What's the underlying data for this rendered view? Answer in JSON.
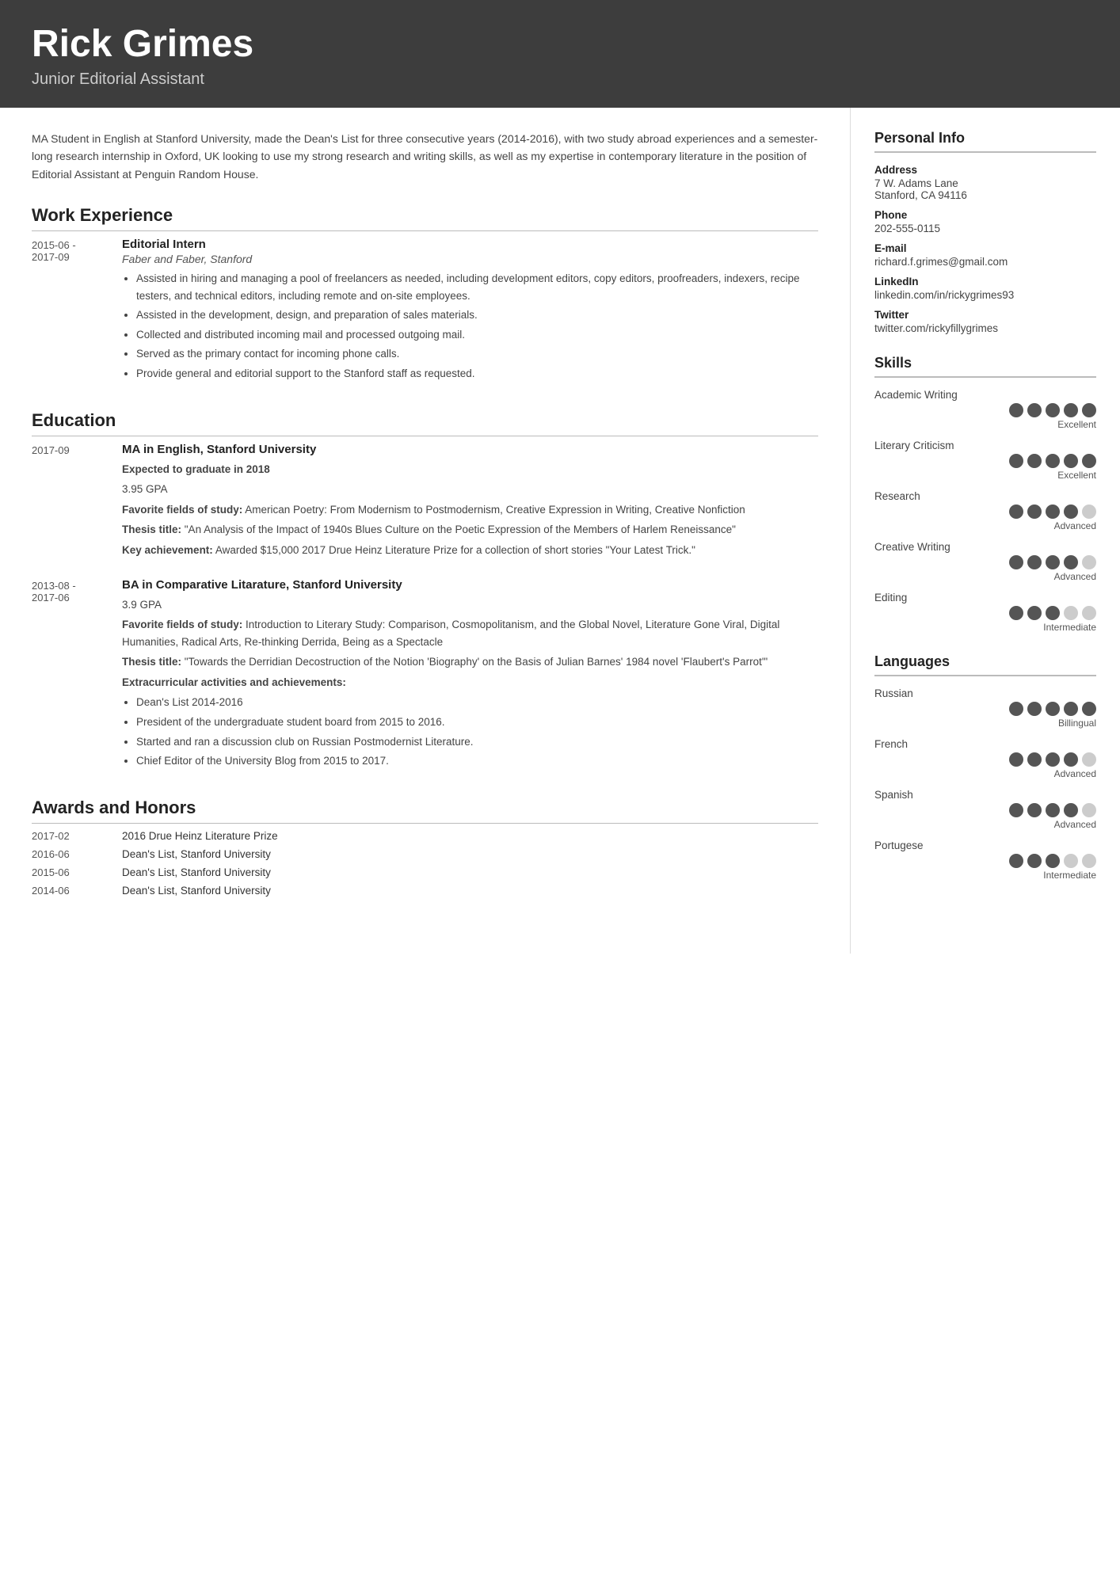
{
  "header": {
    "name": "Rick Grimes",
    "title": "Junior Editorial Assistant"
  },
  "summary": "MA Student in English at Stanford University, made the Dean's List for three consecutive years (2014-2016), with two study abroad experiences and a semester-long research internship in Oxford, UK looking to use my strong research and writing skills, as well as my expertise in contemporary literature in the position of Editorial Assistant at Penguin Random House.",
  "sections": {
    "work_experience": {
      "label": "Work Experience",
      "entries": [
        {
          "date": "2015-06 - 2017-09",
          "title": "Editorial Intern",
          "subtitle": "Faber and Faber, Stanford",
          "bullets": [
            "Assisted in hiring and managing a pool of freelancers as needed, including development editors, copy editors, proofreaders, indexers, recipe testers, and technical editors, including remote and on-site employees.",
            "Assisted in the development, design, and preparation of sales materials.",
            "Collected and distributed incoming mail and processed outgoing mail.",
            "Served as the primary contact for incoming phone calls.",
            "Provide general and editorial support to the Stanford staff as requested."
          ]
        }
      ]
    },
    "education": {
      "label": "Education",
      "entries": [
        {
          "date": "2017-09",
          "title": "MA in English, Stanford University",
          "subtitle": "",
          "details": [
            {
              "bold": true,
              "text": "Expected to graduate in 2018"
            },
            {
              "bold": false,
              "text": "3.95 GPA"
            },
            {
              "bold_prefix": "Favorite fields of study:",
              "text": " American Poetry: From Modernism to Postmodernism, Creative Expression in Writing, Creative Nonfiction"
            },
            {
              "bold_prefix": "Thesis title:",
              "text": " \"An Analysis of the Impact of 1940s Blues Culture on the Poetic Expression of the Members of Harlem Reneissance\""
            },
            {
              "bold_prefix": "Key achievement:",
              "text": " Awarded $15,000 2017 Drue Heinz Literature Prize for a collection of short stories \"Your Latest Trick.\""
            }
          ]
        },
        {
          "date": "2013-08 - 2017-06",
          "title": "BA in Comparative Litarature, Stanford University",
          "subtitle": "",
          "details": [
            {
              "bold": false,
              "text": "3.9 GPA"
            },
            {
              "bold_prefix": "Favorite fields of study:",
              "text": " Introduction to Literary Study: Comparison, Cosmopolitanism, and the Global Novel, Literature Gone Viral, Digital Humanities, Radical Arts, Re-thinking Derrida, Being as a Spectacle"
            },
            {
              "bold_prefix": "Thesis title:",
              "text": " \"Towards the Derridian Decostruction of the Notion 'Biography' on the Basis of Julian Barnes' 1984 novel 'Flaubert's Parrot'\""
            },
            {
              "bold_prefix": "Extracurricular activities and achievements:",
              "text": ""
            }
          ],
          "bullets": [
            "Dean's List 2014-2016",
            "President of the undergraduate student board from 2015 to 2016.",
            "Started and ran a discussion club on Russian Postmodernist Literature.",
            "Chief Editor of the University Blog from 2015 to 2017."
          ]
        }
      ]
    },
    "awards": {
      "label": "Awards and Honors",
      "entries": [
        {
          "date": "2017-02",
          "title": "2016 Drue Heinz Literature Prize"
        },
        {
          "date": "2016-06",
          "title": "Dean's List, Stanford University"
        },
        {
          "date": "2015-06",
          "title": "Dean's List, Stanford University"
        },
        {
          "date": "2014-06",
          "title": "Dean's List, Stanford University"
        }
      ]
    }
  },
  "sidebar": {
    "personal_info": {
      "label": "Personal Info",
      "fields": [
        {
          "label": "Address",
          "value": "7 W. Adams Lane\nStanford, CA 94116"
        },
        {
          "label": "Phone",
          "value": "202-555-0115"
        },
        {
          "label": "E-mail",
          "value": "richard.f.grimes@gmail.com"
        },
        {
          "label": "LinkedIn",
          "value": "linkedin.com/in/rickygrimes93"
        },
        {
          "label": "Twitter",
          "value": "twitter.com/rickyfillygrimes"
        }
      ]
    },
    "skills": {
      "label": "Skills",
      "items": [
        {
          "name": "Academic Writing",
          "filled": 5,
          "total": 5,
          "level": "Excellent"
        },
        {
          "name": "Literary Criticism",
          "filled": 5,
          "total": 5,
          "level": "Excellent"
        },
        {
          "name": "Research",
          "filled": 4,
          "total": 5,
          "level": "Advanced"
        },
        {
          "name": "Creative Writing",
          "filled": 4,
          "total": 5,
          "level": "Advanced"
        },
        {
          "name": "Editing",
          "filled": 3,
          "total": 5,
          "level": "Intermediate"
        }
      ]
    },
    "languages": {
      "label": "Languages",
      "items": [
        {
          "name": "Russian",
          "filled": 5,
          "total": 5,
          "level": "Billingual"
        },
        {
          "name": "French",
          "filled": 4,
          "total": 5,
          "level": "Advanced"
        },
        {
          "name": "Spanish",
          "filled": 4,
          "total": 5,
          "level": "Advanced"
        },
        {
          "name": "Portugese",
          "filled": 3,
          "total": 5,
          "level": "Intermediate"
        }
      ]
    }
  }
}
